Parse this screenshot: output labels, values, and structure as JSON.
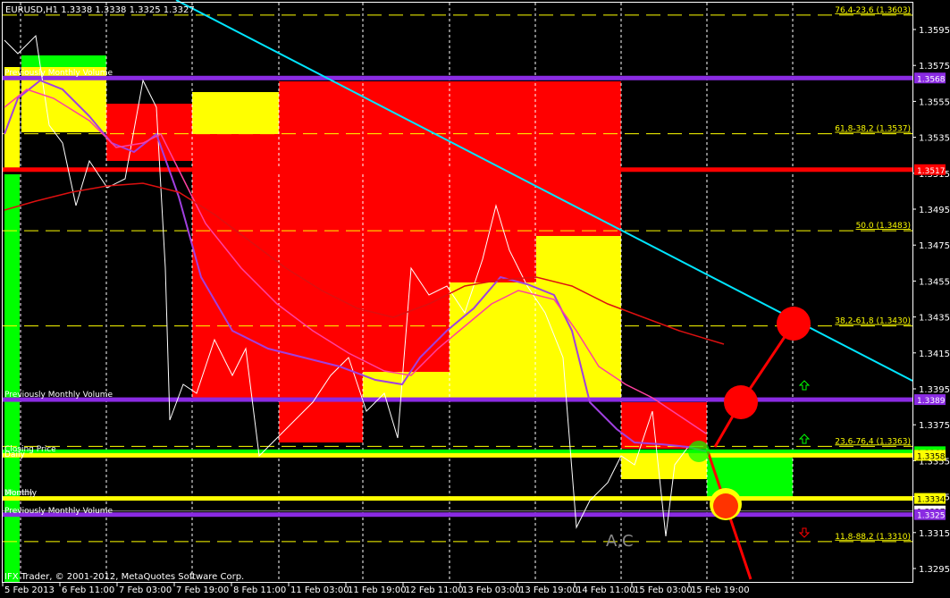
{
  "header": {
    "symbol": "EURUSD,H1",
    "open": "1.3338",
    "high": "1.3338",
    "low": "1.3325",
    "close": "1.3327"
  },
  "footer": {
    "copyright": "IFX Trader, © 2001-2012, MetaQuotes Software Corp."
  },
  "watermark": "A,C",
  "chart_data": {
    "type": "candlestick",
    "symbol": "EURUSD",
    "timeframe": "H1",
    "ylim": [
      1.3285,
      1.361
    ],
    "y_ticks": [
      "1.3595",
      "1.3575",
      "1.3555",
      "1.3535",
      "1.3515",
      "1.3495",
      "1.3475",
      "1.3455",
      "1.3435",
      "1.3415",
      "1.3395",
      "1.3375",
      "1.3355",
      "1.3335",
      "1.3315",
      "1.3295"
    ],
    "x_ticks": [
      "5 Feb 2013",
      "6 Feb 11:00",
      "7 Feb 03:00",
      "7 Feb 19:00",
      "8 Feb 11:00",
      "11 Feb 03:00",
      "11 Feb 19:00",
      "12 Feb 11:00",
      "13 Feb 03:00",
      "13 Feb 19:00",
      "14 Feb 11:00",
      "15 Feb 03:00",
      "15 Feb 19:00"
    ],
    "fib_levels": [
      {
        "label": "76,4-23,6 (1.3603)",
        "price": 1.3603
      },
      {
        "label": "61,8-38,2 (1.3537)",
        "price": 1.3537
      },
      {
        "label": "50.0 (1.3483)",
        "price": 1.3483
      },
      {
        "label": "38,2-61,8 (1.3430)",
        "price": 1.343
      },
      {
        "label": "23,6-76,4 (1.3363)",
        "price": 1.3363
      },
      {
        "label": "11,8-88,2 (1.3310)",
        "price": 1.331
      }
    ],
    "price_lines": [
      {
        "price": 1.3568,
        "tag": "1.3568",
        "color": "#8a2be2"
      },
      {
        "price": 1.3517,
        "tag": "1.3517",
        "color": "#ff0000"
      },
      {
        "price": 1.3389,
        "tag": "1.3389",
        "color": "#8a2be2"
      },
      {
        "price": 1.336,
        "tag": "1.3360",
        "color": "#00ff00"
      },
      {
        "price": 1.3358,
        "tag": "1.3358",
        "color": "#ffff00"
      },
      {
        "price": 1.3334,
        "tag": "1.3334",
        "color": "#ffff00"
      },
      {
        "price": 1.3327,
        "tag": "1.3327",
        "color": "#ffffff"
      },
      {
        "price": 1.3325,
        "tag": "1.3325",
        "color": "#8a2be2"
      }
    ],
    "line_labels": [
      "Previously Monthly Volume",
      "Previously Monthly Volume",
      "Closing Price",
      "Daily",
      "Monthly",
      "Weekly",
      "Previously Monthly Volume"
    ]
  }
}
